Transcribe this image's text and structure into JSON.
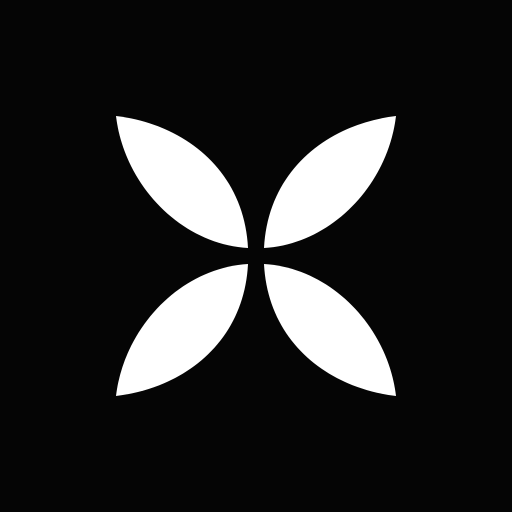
{
  "logo": {
    "icon": "four-petal-flower-icon",
    "petals": [
      "top-left",
      "top-right",
      "bottom-left",
      "bottom-right"
    ]
  },
  "colors": {
    "background": "#050505",
    "petal": "#ffffff"
  }
}
